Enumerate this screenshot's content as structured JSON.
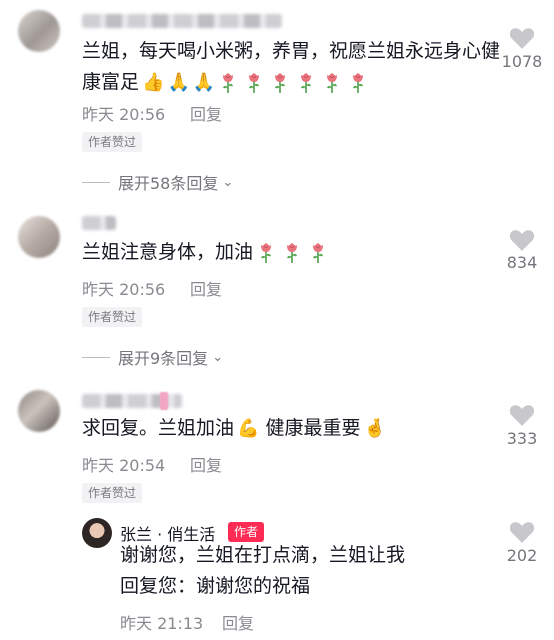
{
  "comments": [
    {
      "text": "兰姐，每天喝小米粥，养胃，祝愿兰姐永远身心健康富足",
      "emojis": [
        "👍",
        "🙏",
        "🙏"
      ],
      "rose_count": 6,
      "time": "昨天 20:56",
      "reply_label": "回复",
      "author_liked": "作者赞过",
      "expand_label": "展开58条回复",
      "likes": "1078"
    },
    {
      "text": "兰姐注意身体，加油",
      "rose_count": 3,
      "time": "昨天 20:56",
      "reply_label": "回复",
      "author_liked": "作者赞过",
      "expand_label": "展开9条回复",
      "likes": "834"
    },
    {
      "text": "求回复。兰姐加油",
      "emoji_muscle": "💪",
      "text_2": "健康最重要",
      "emoji_fingers": "🤞",
      "time": "昨天 20:54",
      "reply_label": "回复",
      "author_liked": "作者赞过",
      "likes": "333"
    }
  ],
  "author_reply": {
    "name": "张兰 · 俏生活",
    "badge": "作者",
    "text": "谢谢您，兰姐在打点滴，兰姐让我回复您：谢谢您的祝福",
    "time": "昨天 21:13",
    "reply_label": "回复",
    "likes": "202"
  },
  "colors": {
    "text": "#161823",
    "secondary": "#8a8b91",
    "badge": "#fe2c55",
    "rose": "#e8737c"
  },
  "icons": [
    "heart-icon",
    "rose-icon",
    "chevron-down-icon"
  ]
}
